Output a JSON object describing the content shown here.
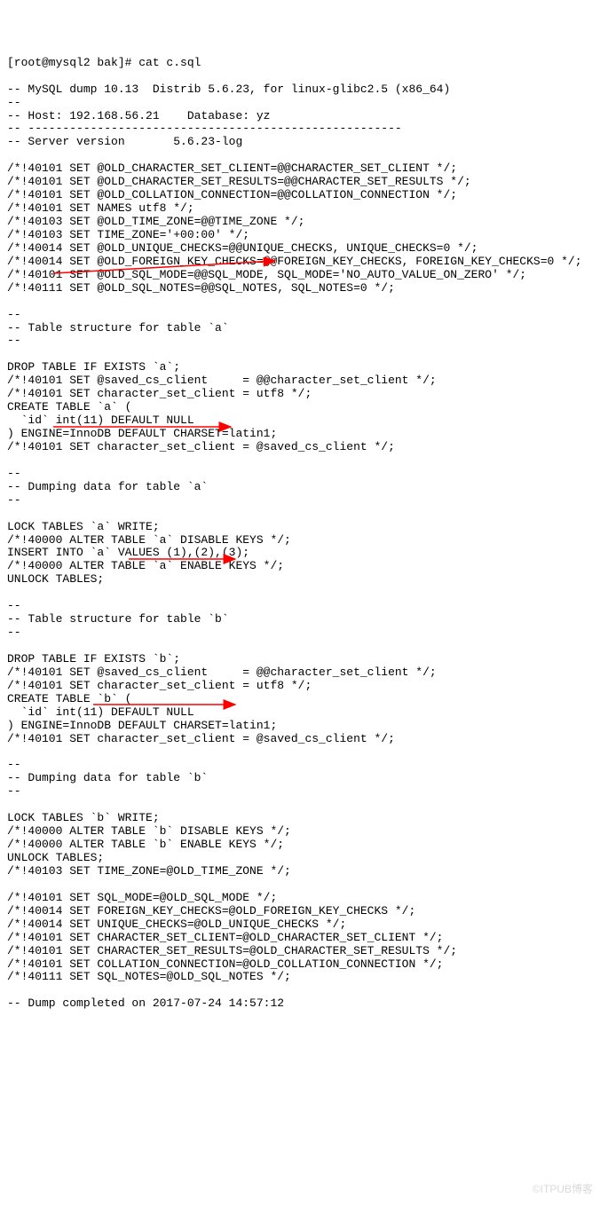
{
  "prompt": "[root@mysql2 bak]# cat c.sql",
  "lines": [
    "-- MySQL dump 10.13  Distrib 5.6.23, for linux-glibc2.5 (x86_64)",
    "--",
    "-- Host: 192.168.56.21    Database: yz",
    "-- ------------------------------------------------------",
    "-- Server version       5.6.23-log",
    "",
    "/*!40101 SET @OLD_CHARACTER_SET_CLIENT=@@CHARACTER_SET_CLIENT */;",
    "/*!40101 SET @OLD_CHARACTER_SET_RESULTS=@@CHARACTER_SET_RESULTS */;",
    "/*!40101 SET @OLD_COLLATION_CONNECTION=@@COLLATION_CONNECTION */;",
    "/*!40101 SET NAMES utf8 */;",
    "/*!40103 SET @OLD_TIME_ZONE=@@TIME_ZONE */;",
    "/*!40103 SET TIME_ZONE='+00:00' */;",
    "/*!40014 SET @OLD_UNIQUE_CHECKS=@@UNIQUE_CHECKS, UNIQUE_CHECKS=0 */;",
    "/*!40014 SET @OLD_FOREIGN_KEY_CHECKS=@@FOREIGN_KEY_CHECKS, FOREIGN_KEY_CHECKS=0 */;",
    "/*!40101 SET @OLD_SQL_MODE=@@SQL_MODE, SQL_MODE='NO_AUTO_VALUE_ON_ZERO' */;",
    "/*!40111 SET @OLD_SQL_NOTES=@@SQL_NOTES, SQL_NOTES=0 */;",
    "",
    "--",
    "-- Table structure for table `a`",
    "--",
    "",
    "DROP TABLE IF EXISTS `a`;",
    "/*!40101 SET @saved_cs_client     = @@character_set_client */;",
    "/*!40101 SET character_set_client = utf8 */;",
    "CREATE TABLE `a` (",
    "  `id` int(11) DEFAULT NULL",
    ") ENGINE=InnoDB DEFAULT CHARSET=latin1;",
    "/*!40101 SET character_set_client = @saved_cs_client */;",
    "",
    "--",
    "-- Dumping data for table `a`",
    "--",
    "",
    "LOCK TABLES `a` WRITE;",
    "/*!40000 ALTER TABLE `a` DISABLE KEYS */;",
    "INSERT INTO `a` VALUES (1),(2),(3);",
    "/*!40000 ALTER TABLE `a` ENABLE KEYS */;",
    "UNLOCK TABLES;",
    "",
    "--",
    "-- Table structure for table `b`",
    "--",
    "",
    "DROP TABLE IF EXISTS `b`;",
    "/*!40101 SET @saved_cs_client     = @@character_set_client */;",
    "/*!40101 SET character_set_client = utf8 */;",
    "CREATE TABLE `b` (",
    "  `id` int(11) DEFAULT NULL",
    ") ENGINE=InnoDB DEFAULT CHARSET=latin1;",
    "/*!40101 SET character_set_client = @saved_cs_client */;",
    "",
    "--",
    "-- Dumping data for table `b`",
    "--",
    "",
    "LOCK TABLES `b` WRITE;",
    "/*!40000 ALTER TABLE `b` DISABLE KEYS */;",
    "/*!40000 ALTER TABLE `b` ENABLE KEYS */;",
    "UNLOCK TABLES;",
    "/*!40103 SET TIME_ZONE=@OLD_TIME_ZONE */;",
    "",
    "/*!40101 SET SQL_MODE=@OLD_SQL_MODE */;",
    "/*!40014 SET FOREIGN_KEY_CHECKS=@OLD_FOREIGN_KEY_CHECKS */;",
    "/*!40014 SET UNIQUE_CHECKS=@OLD_UNIQUE_CHECKS */;",
    "/*!40101 SET CHARACTER_SET_CLIENT=@OLD_CHARACTER_SET_CLIENT */;",
    "/*!40101 SET CHARACTER_SET_RESULTS=@OLD_CHARACTER_SET_RESULTS */;",
    "/*!40101 SET COLLATION_CONNECTION=@OLD_COLLATION_CONNECTION */;",
    "/*!40111 SET SQL_NOTES=@OLD_SQL_NOTES */;",
    "",
    "-- Dump completed on 2017-07-24 14:57:12"
  ],
  "watermark": "©ITPUB博客"
}
